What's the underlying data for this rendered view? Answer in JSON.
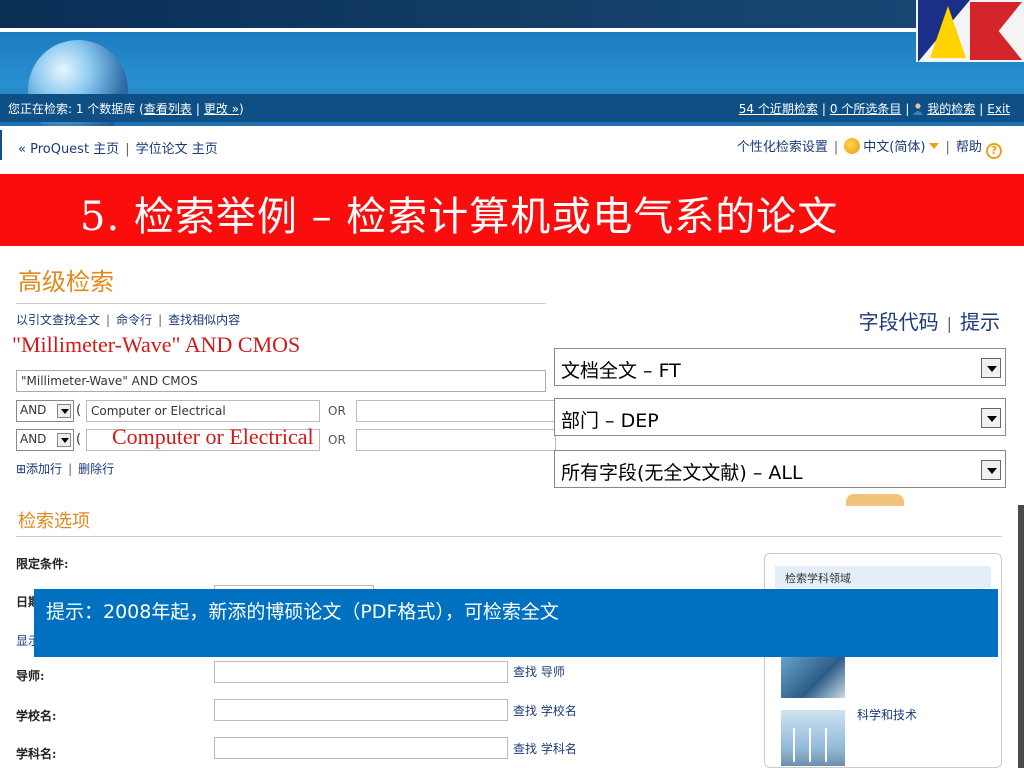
{
  "header": {
    "search_status_prefix": "您正在检索: 1 个数据库 (",
    "view_list": "查看列表",
    "change": "更改 »",
    "search_status_suffix": ")",
    "recent_searches": "54 个近期检索",
    "selected_items": "0 个所选条目",
    "my_searches": "我的检索",
    "exit": "Exit"
  },
  "nav": {
    "proquest_home": "« ProQuest 主页",
    "thesis_home": "学位论文 主页",
    "personalize": "个性化检索设置",
    "language": "中文(简体)",
    "help": "帮助"
  },
  "slide_title": "5. 检索举例  –  检索计算机或电气系的论文",
  "advanced": {
    "title": "高级检索",
    "links": [
      "以引文查找全文",
      "命令行",
      "查找相似内容"
    ],
    "annotation_query": "\"Millimeter-Wave\" AND CMOS",
    "query_value": "\"Millimeter-Wave\" AND CMOS",
    "rows": [
      {
        "op": "AND",
        "value": "Computer or Electrical",
        "or_label": "OR"
      },
      {
        "op": "AND",
        "value": "",
        "or_label": "OR"
      }
    ],
    "annotation_computer": "Computer or Electrical",
    "add_row": "⊞添加行",
    "delete_row": "删除行"
  },
  "fields": {
    "codes": "字段代码",
    "tips": "提示",
    "options": [
      "文档全文 – FT",
      "部门 – DEP",
      "所有字段(无全文文献) – ALL"
    ]
  },
  "options_section": {
    "title": "检索选项",
    "restrict": "限定条件:",
    "date_short": "日期",
    "display_short": "显示",
    "advisor": "导师:",
    "find_advisor": "查找 导师",
    "school": "学校名:",
    "find_school": "查找 学校名",
    "subject": "学科名:",
    "find_subject": "查找 学科名"
  },
  "side": {
    "header": "检索学科领域",
    "item_label": "科学和技术"
  },
  "tip": "提示：2008年起，新添的博硕论文（PDF格式），可检索全文",
  "colors": {
    "title_red": "#fb0d0d",
    "tip_blue": "#0070c0",
    "heading_orange": "#e08a1c",
    "banner_blue": "#1c7cc0"
  }
}
